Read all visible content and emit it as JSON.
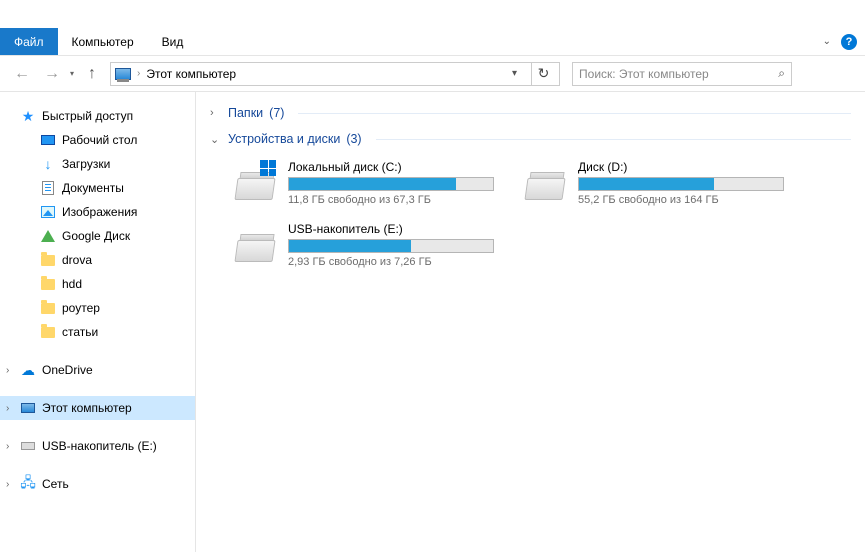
{
  "menubar": {
    "file": "Файл",
    "computer": "Компьютер",
    "view": "Вид"
  },
  "address": {
    "location": "Этот компьютер"
  },
  "search": {
    "placeholder": "Поиск: Этот компьютер"
  },
  "sidebar": {
    "quick_access": "Быстрый доступ",
    "desktop": "Рабочий стол",
    "downloads": "Загрузки",
    "documents": "Документы",
    "pictures": "Изображения",
    "gdrive": "Google Диск",
    "folder_drova": "drova",
    "folder_hdd": "hdd",
    "folder_router": "роутер",
    "folder_articles": "статьи",
    "onedrive": "OneDrive",
    "this_pc": "Этот компьютер",
    "usb_drive": "USB-накопитель (E:)",
    "network": "Сеть"
  },
  "groups": {
    "folders": {
      "label": "Папки",
      "count": "(7)"
    },
    "devices": {
      "label": "Устройства и диски",
      "count": "(3)"
    }
  },
  "drives": [
    {
      "name": "Локальный диск (C:)",
      "sub": "11,8 ГБ свободно из 67,3 ГБ",
      "fill_pct": 82,
      "badge": "windows"
    },
    {
      "name": "Диск (D:)",
      "sub": "55,2 ГБ свободно из 164 ГБ",
      "fill_pct": 66,
      "badge": null
    },
    {
      "name": "USB-накопитель (E:)",
      "sub": "2,93 ГБ свободно из 7,26 ГБ",
      "fill_pct": 60,
      "badge": null
    }
  ]
}
